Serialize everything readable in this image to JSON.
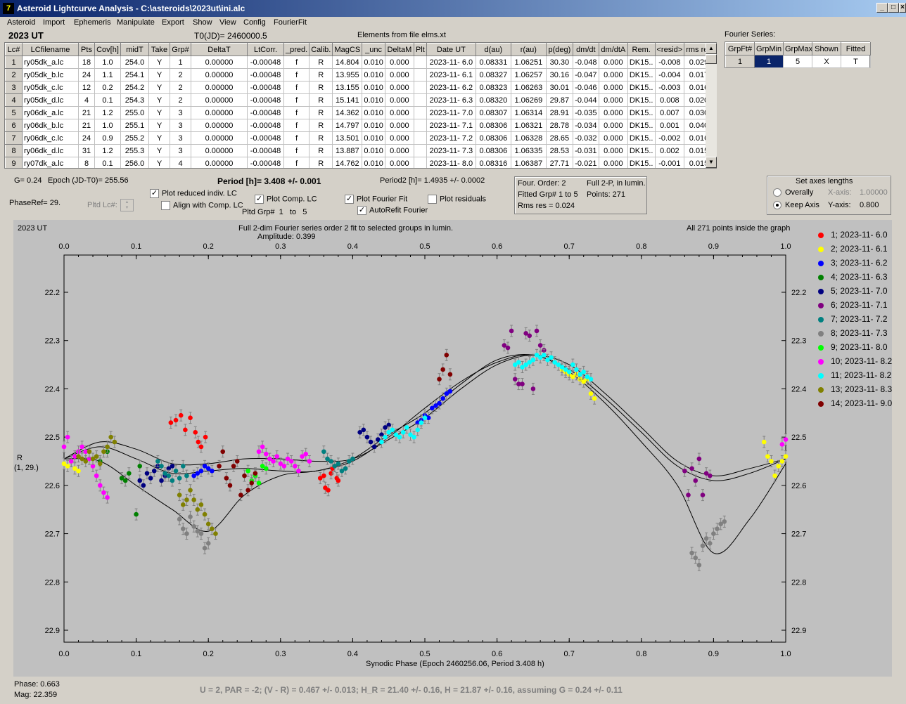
{
  "window": {
    "title": "Asteroid Lightcurve Analysis - C:\\asteroids\\2023ut\\ini.alc",
    "app_icon": "7",
    "minimize": "_",
    "maximize": "□",
    "close": "×"
  },
  "menu": [
    "Asteroid",
    "Import",
    "Ephemeris",
    "Manipulate",
    "Export",
    "Show",
    "View",
    "Config",
    "FourierFit"
  ],
  "header": {
    "object": "2023 UT",
    "t0": "T0(JD)= 2460000.5",
    "elements": "Elements from file elms.xt",
    "fourier_series_label": "Fourier Series:"
  },
  "lc_table": {
    "columns": [
      "Lc#",
      "LCfilename",
      "Pts",
      "Cov[h]",
      "midT",
      "Take",
      "Grp#",
      "DeltaT",
      "LtCorr.",
      "_pred.",
      "Calib.",
      "MagCS",
      "_unc",
      "DeltaM",
      "Plt",
      "Date UT",
      "d(au)",
      "r(au)",
      "p(deg)",
      "dm/dt",
      "dm/dtA",
      "Rem.",
      "<resid>",
      "rms res"
    ],
    "rows": [
      [
        "1",
        "ry05dk_a.lc",
        "18",
        "1.0",
        "254.0",
        "Y",
        "1",
        "0.00000",
        "-0.00048",
        "f",
        "R",
        "14.804",
        "0.010",
        "0.000",
        "",
        "2023-11- 6.0",
        "0.08331",
        "1.06251",
        "30.30",
        "-0.048",
        "0.000",
        "DK15..",
        "-0.008",
        "0.029"
      ],
      [
        "2",
        "ry05dk_b.lc",
        "24",
        "1.1",
        "254.1",
        "Y",
        "2",
        "0.00000",
        "-0.00048",
        "f",
        "R",
        "13.955",
        "0.010",
        "0.000",
        "",
        "2023-11- 6.1",
        "0.08327",
        "1.06257",
        "30.16",
        "-0.047",
        "0.000",
        "DK15..",
        "-0.004",
        "0.017"
      ],
      [
        "3",
        "ry05dk_c.lc",
        "12",
        "0.2",
        "254.2",
        "Y",
        "2",
        "0.00000",
        "-0.00048",
        "f",
        "R",
        "13.155",
        "0.010",
        "0.000",
        "",
        "2023-11- 6.2",
        "0.08323",
        "1.06263",
        "30.01",
        "-0.046",
        "0.000",
        "DK15..",
        "-0.003",
        "0.016"
      ],
      [
        "4",
        "ry05dk_d.lc",
        "4",
        "0.1",
        "254.3",
        "Y",
        "2",
        "0.00000",
        "-0.00048",
        "f",
        "R",
        "15.141",
        "0.010",
        "0.000",
        "",
        "2023-11- 6.3",
        "0.08320",
        "1.06269",
        "29.87",
        "-0.044",
        "0.000",
        "DK15..",
        "0.008",
        "0.020"
      ],
      [
        "5",
        "ry06dk_a.lc",
        "21",
        "1.2",
        "255.0",
        "Y",
        "3",
        "0.00000",
        "-0.00048",
        "f",
        "R",
        "14.362",
        "0.010",
        "0.000",
        "",
        "2023-11- 7.0",
        "0.08307",
        "1.06314",
        "28.91",
        "-0.035",
        "0.000",
        "DK15..",
        "0.007",
        "0.030"
      ],
      [
        "6",
        "ry06dk_b.lc",
        "21",
        "1.0",
        "255.1",
        "Y",
        "3",
        "0.00000",
        "-0.00048",
        "f",
        "R",
        "14.797",
        "0.010",
        "0.000",
        "",
        "2023-11- 7.1",
        "0.08306",
        "1.06321",
        "28.78",
        "-0.034",
        "0.000",
        "DK15..",
        "0.001",
        "0.040"
      ],
      [
        "7",
        "ry06dk_c.lc",
        "24",
        "0.9",
        "255.2",
        "Y",
        "3",
        "0.00000",
        "-0.00048",
        "f",
        "R",
        "13.501",
        "0.010",
        "0.000",
        "",
        "2023-11- 7.2",
        "0.08306",
        "1.06328",
        "28.65",
        "-0.032",
        "0.000",
        "DK15..",
        "-0.002",
        "0.016"
      ],
      [
        "8",
        "ry06dk_d.lc",
        "31",
        "1.2",
        "255.3",
        "Y",
        "3",
        "0.00000",
        "-0.00048",
        "f",
        "R",
        "13.887",
        "0.010",
        "0.000",
        "",
        "2023-11- 7.3",
        "0.08306",
        "1.06335",
        "28.53",
        "-0.031",
        "0.000",
        "DK15..",
        "0.002",
        "0.015"
      ],
      [
        "9",
        "ry07dk_a.lc",
        "8",
        "0.1",
        "256.0",
        "Y",
        "4",
        "0.00000",
        "-0.00048",
        "f",
        "R",
        "14.762",
        "0.010",
        "0.000",
        "",
        "2023-11- 8.0",
        "0.08316",
        "1.06387",
        "27.71",
        "-0.021",
        "0.000",
        "DK15..",
        "-0.001",
        "0.015"
      ]
    ]
  },
  "fourier_table": {
    "columns": [
      "GrpFt#",
      "GrpMin",
      "GrpMax",
      "Shown",
      "Fitted"
    ],
    "row": [
      "1",
      "1",
      "5",
      "X",
      "T"
    ]
  },
  "controls": {
    "g": "G= 0.24",
    "epoch": "Epoch (JD-T0)= 255.56",
    "period": "Period [h]= 3.408 +/- 0.001",
    "period2": "Period2 [h]= 1.4935 +/- 0.0002",
    "phaseref": "PhaseRef= 29.",
    "pltd_lc": "Pltd Lc#:",
    "plot_reduced": "Plot reduced indiv. LC",
    "align_comp": "Align with Comp. LC",
    "plot_comp": "Plot Comp. LC",
    "pltd_grp_label": "Pltd Grp#",
    "pltd_grp_from": "1",
    "pltd_grp_to_word": "to",
    "pltd_grp_to": "5",
    "plot_fourier": "Plot Fourier Fit",
    "plot_residuals": "Plot residuals",
    "autorefit": "AutoRefit Fourier",
    "check_mark": "✓"
  },
  "fourier_info": {
    "order": "Four. Order:  2",
    "fitted": "Fitted Grp# 1 to 5",
    "rms": "Rms res      = 0.024",
    "full2p": "Full 2-P, in lumin.",
    "points": "Points: 271"
  },
  "axes_box": {
    "title": "Set axes lengths",
    "overally": "Overally",
    "keep_axis": "Keep Axis",
    "xaxis_label": "X-axis:",
    "xaxis_value": "1.00000",
    "yaxis_label": "Y-axis:",
    "yaxis_value": "0.800"
  },
  "graph": {
    "object": "2023 UT",
    "title": "Full 2-dim Fourier series order 2 fit to selected groups in lumin.",
    "amplitude": "Amplitude: 0.399",
    "points_note": "All 271 points inside the graph",
    "ylabel": "R",
    "ylabel2": "(1, 29.)",
    "xlabel": "Synodic Phase (Epoch 2460256.06, Period 3.408 h)"
  },
  "chart_data": {
    "type": "scatter",
    "xlim": [
      0.0,
      1.0
    ],
    "ylim": [
      22.9,
      22.1
    ],
    "y_inverted": true,
    "x_ticks": [
      "0.0",
      "0.1",
      "0.2",
      "0.3",
      "0.4",
      "0.5",
      "0.6",
      "0.7",
      "0.8",
      "0.9",
      "1.0"
    ],
    "y_ticks": [
      "22.2",
      "22.3",
      "22.4",
      "22.5",
      "22.6",
      "22.7",
      "22.8",
      "22.9"
    ],
    "grid": false,
    "legend_position": "right",
    "series": [
      {
        "name": "1; 2023-11- 6.0",
        "color": "#ff0000",
        "x": [
          0.148,
          0.155,
          0.162,
          0.168,
          0.175,
          0.182,
          0.186,
          0.19,
          0.196,
          0.355,
          0.36,
          0.362,
          0.366,
          0.37,
          0.372,
          0.375,
          0.378,
          0.38
        ],
        "y": [
          22.47,
          22.465,
          22.455,
          22.485,
          22.46,
          22.49,
          22.51,
          22.52,
          22.5,
          22.585,
          22.58,
          22.605,
          22.61,
          22.575,
          22.565,
          22.56,
          22.585,
          22.59
        ]
      },
      {
        "name": "2; 2023-11- 6.1",
        "color": "#ffff00",
        "x": [
          0.0,
          0.005,
          0.01,
          0.015,
          0.02,
          0.69,
          0.695,
          0.7,
          0.705,
          0.71,
          0.715,
          0.72,
          0.725,
          0.73,
          0.735,
          0.97,
          0.975,
          0.98,
          0.985,
          0.99,
          0.995,
          1.0
        ],
        "y": [
          22.555,
          22.56,
          22.55,
          22.565,
          22.57,
          22.36,
          22.365,
          22.37,
          22.375,
          22.37,
          22.38,
          22.385,
          22.38,
          22.41,
          22.42,
          22.51,
          22.54,
          22.55,
          22.58,
          22.56,
          22.55,
          22.54
        ]
      },
      {
        "name": "3; 2023-11- 6.2",
        "color": "#0000ff",
        "x": [
          0.18,
          0.185,
          0.19,
          0.195,
          0.2,
          0.205,
          0.49,
          0.495,
          0.5,
          0.505,
          0.51,
          0.515,
          0.52,
          0.525,
          0.53,
          0.535
        ],
        "y": [
          22.58,
          22.575,
          22.57,
          22.56,
          22.565,
          22.57,
          22.47,
          22.465,
          22.455,
          22.46,
          22.44,
          22.435,
          22.43,
          22.42,
          22.41,
          22.405
        ]
      },
      {
        "name": "4; 2023-11- 6.3",
        "color": "#008000",
        "x": [
          0.05,
          0.06,
          0.08,
          0.085,
          0.09,
          0.1,
          0.105
        ],
        "y": [
          22.55,
          22.53,
          22.585,
          22.59,
          22.575,
          22.66,
          22.56
        ]
      },
      {
        "name": "5; 2023-11- 7.0",
        "color": "#000080",
        "x": [
          0.105,
          0.11,
          0.115,
          0.12,
          0.125,
          0.13,
          0.135,
          0.14,
          0.145,
          0.15,
          0.41,
          0.415,
          0.42,
          0.425,
          0.43,
          0.435,
          0.44,
          0.445,
          0.45
        ],
        "y": [
          22.59,
          22.6,
          22.575,
          22.585,
          22.57,
          22.56,
          22.59,
          22.58,
          22.565,
          22.56,
          22.49,
          22.485,
          22.5,
          22.51,
          22.52,
          22.505,
          22.495,
          22.48,
          22.475
        ]
      },
      {
        "name": "6; 2023-11- 7.1",
        "color": "#800080",
        "x": [
          0.61,
          0.615,
          0.62,
          0.625,
          0.63,
          0.635,
          0.64,
          0.645,
          0.65,
          0.655,
          0.66,
          0.665,
          0.86,
          0.865,
          0.87,
          0.875,
          0.88,
          0.885,
          0.89,
          0.895
        ],
        "y": [
          22.31,
          22.315,
          22.28,
          22.38,
          22.39,
          22.39,
          22.285,
          22.29,
          22.4,
          22.28,
          22.31,
          22.32,
          22.57,
          22.62,
          22.565,
          22.59,
          22.545,
          22.62,
          22.575,
          22.58
        ]
      },
      {
        "name": "7; 2023-11- 7.2",
        "color": "#008080",
        "x": [
          0.13,
          0.135,
          0.14,
          0.145,
          0.15,
          0.155,
          0.16,
          0.165,
          0.17,
          0.36,
          0.365,
          0.37,
          0.375,
          0.38,
          0.385,
          0.39,
          0.395,
          0.4
        ],
        "y": [
          22.55,
          22.56,
          22.575,
          22.58,
          22.59,
          22.57,
          22.585,
          22.56,
          22.58,
          22.53,
          22.545,
          22.55,
          22.56,
          22.555,
          22.57,
          22.565,
          22.55,
          22.545
        ]
      },
      {
        "name": "8; 2023-11- 7.3",
        "color": "#808080",
        "x": [
          0.16,
          0.165,
          0.17,
          0.175,
          0.18,
          0.185,
          0.19,
          0.195,
          0.2,
          0.205,
          0.87,
          0.875,
          0.88,
          0.885,
          0.89,
          0.895,
          0.9,
          0.905,
          0.91,
          0.915
        ],
        "y": [
          22.67,
          22.69,
          22.7,
          22.665,
          22.685,
          22.695,
          22.7,
          22.73,
          22.72,
          22.69,
          22.74,
          22.75,
          22.765,
          22.725,
          22.71,
          22.72,
          22.7,
          22.69,
          22.68,
          22.675
        ]
      },
      {
        "name": "9; 2023-11- 8.0",
        "color": "#00ff00",
        "x": [
          0.255,
          0.26,
          0.265,
          0.27,
          0.275,
          0.28
        ],
        "y": [
          22.57,
          22.59,
          22.58,
          22.595,
          22.56,
          22.565
        ]
      },
      {
        "name": "10; 2023-11- 8.2",
        "color": "#ff00ff",
        "x": [
          0.0,
          0.005,
          0.01,
          0.015,
          0.02,
          0.025,
          0.03,
          0.035,
          0.04,
          0.045,
          0.05,
          0.055,
          0.06,
          0.27,
          0.275,
          0.28,
          0.285,
          0.29,
          0.295,
          0.3,
          0.305,
          0.31,
          0.315,
          0.32,
          0.325,
          0.33,
          0.335,
          0.34,
          0.995,
          1.0
        ],
        "y": [
          22.52,
          22.5,
          22.55,
          22.54,
          22.53,
          22.52,
          22.53,
          22.545,
          22.56,
          22.58,
          22.6,
          22.615,
          22.625,
          22.53,
          22.52,
          22.535,
          22.545,
          22.55,
          22.54,
          22.555,
          22.56,
          22.545,
          22.55,
          22.56,
          22.57,
          22.54,
          22.535,
          22.55,
          22.515,
          22.505
        ]
      },
      {
        "name": "11; 2023-11- 8.2",
        "color": "#00ffff",
        "x": [
          0.44,
          0.445,
          0.45,
          0.455,
          0.46,
          0.465,
          0.47,
          0.475,
          0.48,
          0.485,
          0.49,
          0.495,
          0.5,
          0.625,
          0.63,
          0.635,
          0.64,
          0.645,
          0.65,
          0.655,
          0.66,
          0.665,
          0.67,
          0.675,
          0.68,
          0.685,
          0.69,
          0.695,
          0.7,
          0.705,
          0.71,
          0.715,
          0.72,
          0.725,
          0.73
        ],
        "y": [
          22.51,
          22.5,
          22.49,
          22.485,
          22.495,
          22.5,
          22.49,
          22.48,
          22.495,
          22.5,
          22.485,
          22.47,
          22.46,
          22.35,
          22.345,
          22.355,
          22.35,
          22.345,
          22.34,
          22.33,
          22.335,
          22.33,
          22.34,
          22.335,
          22.345,
          22.35,
          22.355,
          22.36,
          22.365,
          22.35,
          22.36,
          22.37,
          22.365,
          22.375,
          22.38
        ]
      },
      {
        "name": "13; 2023-11- 8.3",
        "color": "#808000",
        "x": [
          0.02,
          0.025,
          0.03,
          0.035,
          0.04,
          0.045,
          0.05,
          0.055,
          0.06,
          0.065,
          0.07,
          0.16,
          0.165,
          0.17,
          0.175,
          0.18,
          0.185,
          0.19,
          0.195,
          0.2,
          0.205,
          0.21
        ],
        "y": [
          22.54,
          22.545,
          22.55,
          22.53,
          22.545,
          22.54,
          22.555,
          22.53,
          22.52,
          22.5,
          22.51,
          22.62,
          22.64,
          22.63,
          22.61,
          22.63,
          22.65,
          22.64,
          22.66,
          22.68,
          22.69,
          22.7
        ]
      },
      {
        "name": "14; 2023-11- 9.0",
        "color": "#800000",
        "x": [
          0.215,
          0.22,
          0.225,
          0.23,
          0.235,
          0.24,
          0.245,
          0.25,
          0.255,
          0.26,
          0.265,
          0.52,
          0.525,
          0.53,
          0.535
        ],
        "y": [
          22.56,
          22.53,
          22.585,
          22.6,
          22.56,
          22.55,
          22.62,
          22.58,
          22.61,
          22.595,
          22.575,
          22.38,
          22.36,
          22.33,
          22.37
        ]
      }
    ],
    "fit_curves": [
      {
        "name": "main",
        "x": [
          0.0,
          0.05,
          0.1,
          0.15,
          0.2,
          0.25,
          0.3,
          0.35,
          0.4,
          0.45,
          0.5,
          0.55,
          0.6,
          0.65,
          0.7,
          0.75,
          0.8,
          0.85,
          0.9,
          0.95,
          1.0
        ],
        "y": [
          22.545,
          22.52,
          22.545,
          22.575,
          22.57,
          22.565,
          22.57,
          22.57,
          22.545,
          22.495,
          22.45,
          22.39,
          22.34,
          22.33,
          22.36,
          22.42,
          22.49,
          22.56,
          22.59,
          22.575,
          22.545
        ]
      },
      {
        "name": "upper",
        "x": [
          0.0,
          0.05,
          0.1,
          0.15,
          0.2,
          0.25,
          0.3,
          0.35,
          0.4,
          0.45,
          0.5,
          0.55,
          0.6,
          0.65,
          0.7,
          0.75,
          0.8,
          0.85,
          0.9,
          0.95,
          1.0
        ],
        "y": [
          22.545,
          22.51,
          22.525,
          22.555,
          22.555,
          22.545,
          22.545,
          22.55,
          22.545,
          22.505,
          22.46,
          22.4,
          22.35,
          22.33,
          22.35,
          22.41,
          22.48,
          22.55,
          22.58,
          22.565,
          22.545
        ]
      },
      {
        "name": "lower",
        "x": [
          0.0,
          0.05,
          0.1,
          0.15,
          0.2,
          0.25,
          0.3,
          0.35,
          0.4,
          0.45,
          0.5,
          0.55,
          0.6,
          0.65,
          0.7,
          0.75,
          0.8,
          0.85,
          0.9,
          0.95,
          1.0
        ],
        "y": [
          22.545,
          22.55,
          22.6,
          22.65,
          22.695,
          22.62,
          22.58,
          22.57,
          22.55,
          22.5,
          22.44,
          22.385,
          22.345,
          22.33,
          22.365,
          22.43,
          22.51,
          22.6,
          22.74,
          22.67,
          22.555
        ]
      }
    ]
  },
  "status": {
    "phase": "Phase:  0.663",
    "mag": "Mag:    22.359",
    "summary": "U = 2, PAR = -2; (V - R) = 0.467 +/- 0.013; H_R = 21.40 +/- 0.16, H = 21.87 +/- 0.16, assuming G = 0.24 +/- 0.11"
  }
}
